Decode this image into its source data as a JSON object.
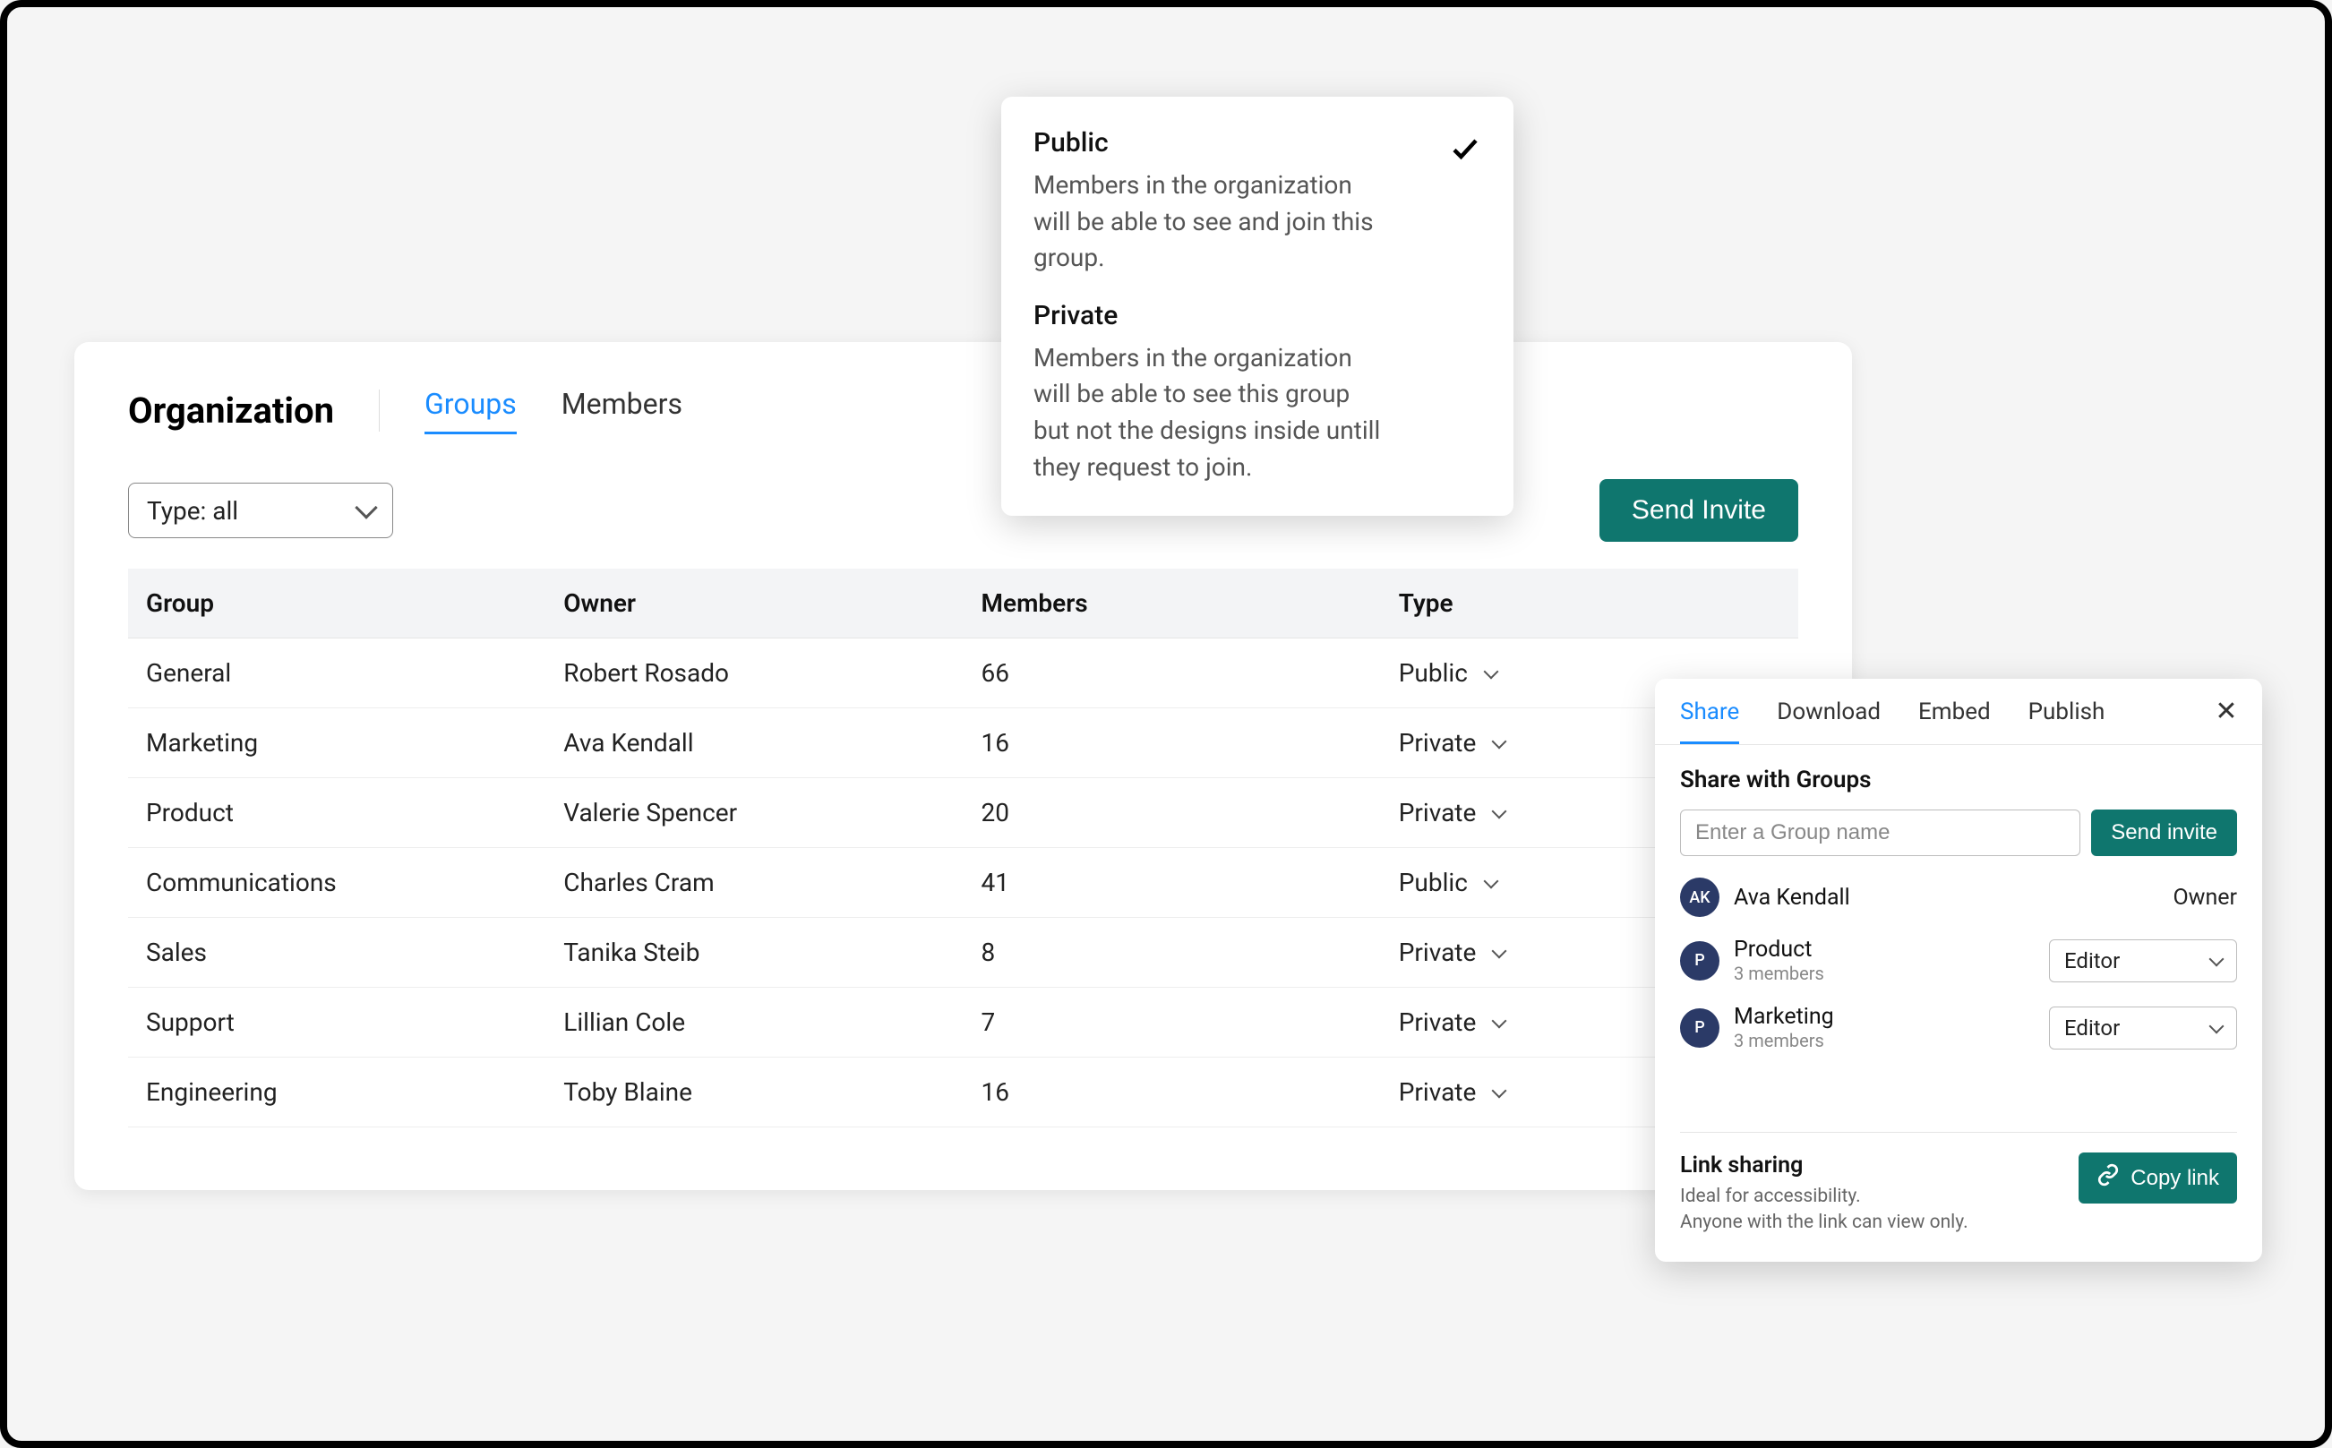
{
  "org": {
    "title": "Organization",
    "tabs": {
      "groups": "Groups",
      "members": "Members"
    },
    "filter_label": "Type: all",
    "send_invite": "Send Invite",
    "columns": {
      "group": "Group",
      "owner": "Owner",
      "members": "Members",
      "type": "Type"
    },
    "rows": [
      {
        "group": "General",
        "owner": "Robert Rosado",
        "members": "66",
        "type": "Public"
      },
      {
        "group": "Marketing",
        "owner": "Ava Kendall",
        "members": "16",
        "type": "Private"
      },
      {
        "group": "Product",
        "owner": "Valerie Spencer",
        "members": "20",
        "type": "Private"
      },
      {
        "group": "Communications",
        "owner": "Charles Cram",
        "members": "41",
        "type": "Public"
      },
      {
        "group": "Sales",
        "owner": "Tanika Steib",
        "members": "8",
        "type": "Private"
      },
      {
        "group": "Support",
        "owner": "Lillian Cole",
        "members": "7",
        "type": "Private"
      },
      {
        "group": "Engineering",
        "owner": "Toby Blaine",
        "members": "16",
        "type": "Private"
      }
    ]
  },
  "visibility": {
    "public_title": "Public",
    "public_desc": "Members in the organization will be able to see and join this group.",
    "private_title": "Private",
    "private_desc": "Members in the organization will be able to see this group but not the designs inside untill they request to join."
  },
  "share": {
    "tabs": {
      "share": "Share",
      "download": "Download",
      "embed": "Embed",
      "publish": "Publish"
    },
    "heading": "Share with Groups",
    "input_placeholder": "Enter a Group name",
    "send_invite": "Send invite",
    "owner_name": "Ava Kendall",
    "owner_avatar": "AK",
    "owner_role": "Owner",
    "groups": [
      {
        "avatar": "P",
        "name": "Product",
        "sub": "3 members",
        "role": "Editor"
      },
      {
        "avatar": "P",
        "name": "Marketing",
        "sub": "3 members",
        "role": "Editor"
      }
    ],
    "link_title": "Link sharing",
    "link_desc1": "Ideal for accessibility.",
    "link_desc2": "Anyone with the link can view only.",
    "copy_link": "Copy link"
  }
}
